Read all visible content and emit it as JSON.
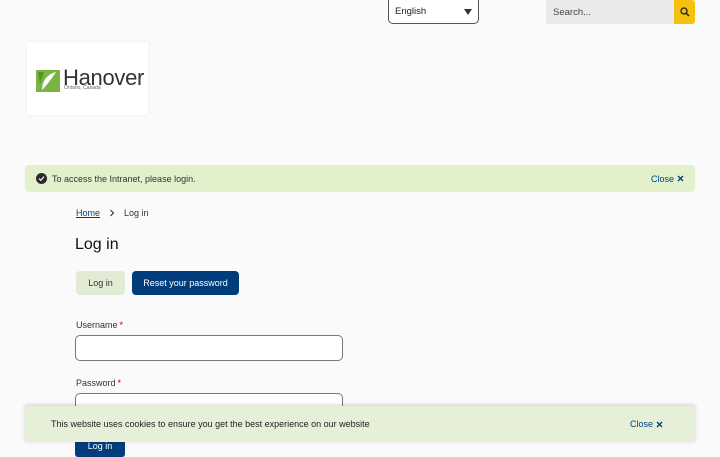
{
  "header": {
    "language": "English",
    "search_placeholder": "Search..."
  },
  "logo": {
    "name": "Hanover",
    "subtitle": "Ontario, Canada",
    "colors": {
      "green": "#7cb342",
      "dark_green": "#3e7d1f"
    }
  },
  "alert": {
    "message": "To access the Intranet, please login.",
    "close_label": "Close"
  },
  "breadcrumb": {
    "home": "Home",
    "current": "Log in"
  },
  "page": {
    "title": "Log in"
  },
  "tabs": {
    "login": "Log in",
    "reset": "Reset your password"
  },
  "form": {
    "username_label": "Username",
    "password_label": "Password",
    "required_mark": "*",
    "submit_label": "Log in"
  },
  "cookie_banner": {
    "message": "This website uses cookies to ensure you get the best experience on our website",
    "close_label": "Close"
  },
  "colors": {
    "accent": "#003d7a",
    "search_button": "#f4c20d",
    "alert_bg": "#e2f0cc"
  }
}
